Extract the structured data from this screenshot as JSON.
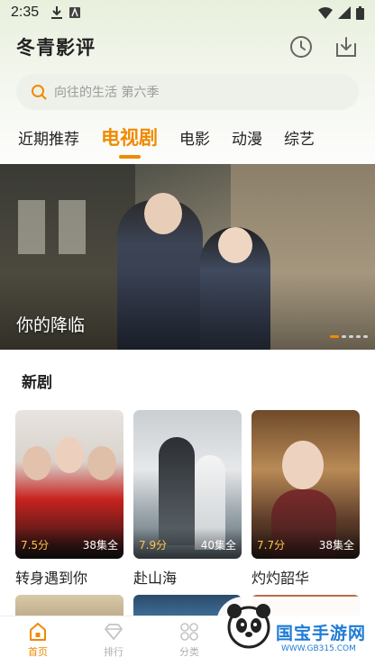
{
  "status_bar": {
    "time": "2:35"
  },
  "header": {
    "title": "冬青影评"
  },
  "search": {
    "placeholder": "向往的生活 第六季"
  },
  "tabs": [
    {
      "label": "近期推荐",
      "active": false
    },
    {
      "label": "电视剧",
      "active": true
    },
    {
      "label": "电影",
      "active": false
    },
    {
      "label": "动漫",
      "active": false
    },
    {
      "label": "综艺",
      "active": false
    }
  ],
  "banner": {
    "title": "你的降临",
    "slides": 5,
    "current_slide": 1
  },
  "new_dramas": {
    "title": "新剧",
    "items": [
      {
        "title": "转身遇到你",
        "score": "7.5分",
        "episodes": "38集全"
      },
      {
        "title": "赴山海",
        "score": "7.9分",
        "episodes": "40集全"
      },
      {
        "title": "灼灼韶华",
        "score": "7.7分",
        "episodes": "38集全"
      }
    ]
  },
  "bottom_nav": [
    {
      "label": "首页",
      "icon": "home-icon",
      "active": true
    },
    {
      "label": "排行",
      "icon": "diamond-icon",
      "active": false
    },
    {
      "label": "分类",
      "icon": "grid-icon",
      "active": false
    }
  ],
  "watermark": {
    "text": "国宝手游网",
    "url": "WWW.GB315.COM"
  },
  "colors": {
    "accent": "#f08a00",
    "score": "#ffc54a",
    "watermark": "#1f7bd6"
  }
}
